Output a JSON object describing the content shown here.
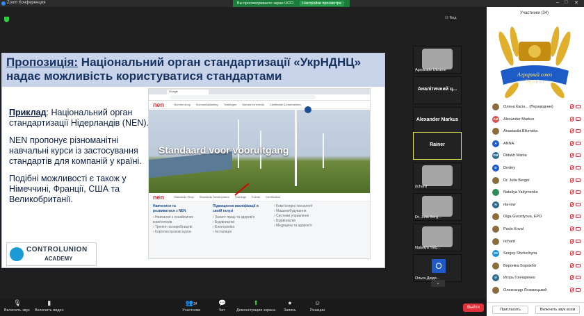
{
  "window": {
    "title": "Zoom Конференция"
  },
  "share_bar": {
    "status": "Вы просматриваете экран UCCI",
    "view_options": "Настройки просмотра"
  },
  "view_option_label": "Вид",
  "slide": {
    "title_underlined": "Пропозиція:",
    "title_rest": " Національний орган стандартизації «УкрНДНЦ» надає можливість користуватися стандартами",
    "example_label": "Приклад",
    "p1": ": Національний орган стандартизації Нідерландів (NEN).",
    "p2": "NEN пропонує різноманітні навчальні курси із застосування стандартів для компаній у країні.",
    "p3": "Подібні можливості є також у Німеччині, Франції, США та Великобританії.",
    "logo_line1": "CONTROLUNION",
    "logo_line2": "ACADEMY"
  },
  "browser": {
    "tab": "Google",
    "logo": "nen",
    "hero_text": "Standaard voor vooruitgang",
    "menu_top": [
      "Normen shop",
      "Normontwikkeling",
      "Trainingen",
      "Nieuws en events",
      "Certificatie & keurmerken"
    ],
    "menu_bottom": [
      "Standards Shop",
      "Standards Development",
      "Trainings",
      "Events",
      "Certification"
    ],
    "col1_title": "Навчатися та розвиватися з NEN",
    "col1_items": [
      "Навчання з ознайомчих комп'ютерів",
      "Тренінг на виробництві",
      "Короткострокові курси"
    ],
    "col2_title": "Підвищення кваліфікації в своїй галузі",
    "col2_items": [
      "Захист праці та здоров'я",
      "Будівництво",
      "Електроніка",
      "Інсталяція"
    ],
    "col3_items": [
      "Комп'ютерні технології",
      "Машинобудування",
      "Системи управління",
      "Будівництво",
      "Медицина та здоров'я"
    ]
  },
  "video_tiles": [
    {
      "name": "Agrotrade Ukraine",
      "centered": false
    },
    {
      "name": "Аналітичний ц...",
      "centered": true
    },
    {
      "name": "Alexander Markus",
      "centered": true
    },
    {
      "name": "Rainer",
      "centered": true
    },
    {
      "name": "richard",
      "centered": false
    },
    {
      "name": "Dr. Julia Berg...",
      "centered": false
    },
    {
      "name": "Nataliya Yakj...",
      "centered": false
    },
    {
      "name": "Ольга Дюдя...",
      "centered": false
    }
  ],
  "tile_o_letter": "O",
  "panel": {
    "title": "Участники (34)",
    "emblem_line1": "Аграрний союз",
    "emblem_line2": "України",
    "participants": [
      {
        "initials": "",
        "color": "#8a6d3b",
        "name": "Оляна Касін... (Переводчик)"
      },
      {
        "initials": "AM",
        "color": "#d9534f",
        "name": "Alexander Markus"
      },
      {
        "initials": "",
        "color": "#8a6d3b",
        "name": "Anastasiia Bliumska"
      },
      {
        "initials": "A",
        "color": "#1e5bc6",
        "name": "ANNA."
      },
      {
        "initials": "DM",
        "color": "#2d6a8f",
        "name": "Didukh Mariia"
      },
      {
        "initials": "D",
        "color": "#1e5bc6",
        "name": "Dmitriy"
      },
      {
        "initials": "",
        "color": "#8a6d3b",
        "name": "Dr. Julia Berger"
      },
      {
        "initials": "",
        "color": "#2e8b57",
        "name": "Nataliya Yakymenko"
      },
      {
        "initials": "N",
        "color": "#2d6a8f",
        "name": "nla-law"
      },
      {
        "initials": "",
        "color": "#8a6d3b",
        "name": "Olga Gvozdyova, EPO"
      },
      {
        "initials": "",
        "color": "#8a6d3b",
        "name": "Pavlo Koval"
      },
      {
        "initials": "",
        "color": "#8a6d3b",
        "name": "richard"
      },
      {
        "initials": "SS",
        "color": "#1e8fd6",
        "name": "Sergey Shcherbyna"
      },
      {
        "initials": "",
        "color": "#8a6d3b",
        "name": "Вероніка Борожбіт"
      },
      {
        "initials": "И",
        "color": "#2d6a8f",
        "name": "Игорь Гончаренко"
      },
      {
        "initials": "",
        "color": "#8a6d3b",
        "name": "Олександр Лозовицький"
      }
    ],
    "invite_label": "Пригласить",
    "mute_all_label": "Включить звук всем"
  },
  "toolbar": {
    "audio": "Включить звук",
    "video": "Включить видео",
    "participants_count": "34",
    "participants": "Участники",
    "chat": "Чат",
    "share": "Демонстрация экрана",
    "record": "Запись",
    "reactions": "Реакции",
    "leave": "Выйти"
  }
}
